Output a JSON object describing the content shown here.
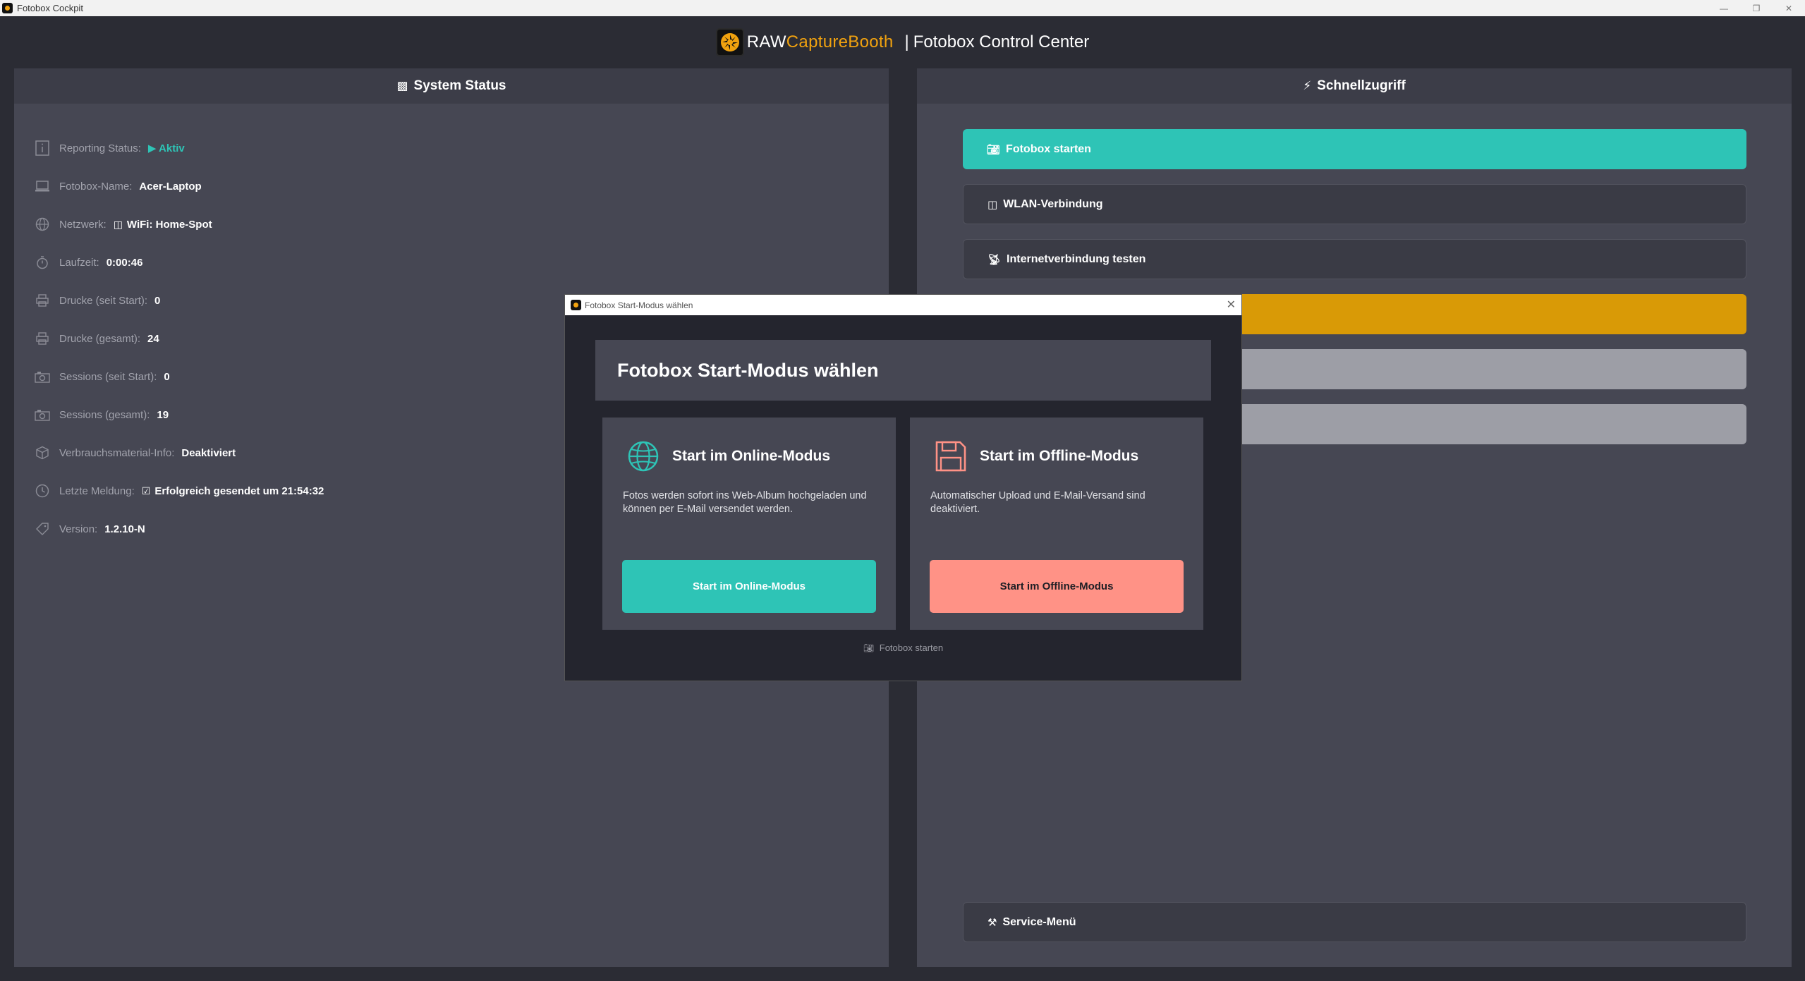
{
  "window": {
    "title": "Fotobox Cockpit",
    "controls": [
      "—",
      "❐",
      "✕"
    ]
  },
  "header": {
    "brand_raw": "RAW",
    "brand_capture": "CaptureBooth",
    "separator": "|",
    "subtitle": "Fotobox Control Center"
  },
  "system_status": {
    "title": "System Status",
    "rows": [
      {
        "icon": "info-icon",
        "label": "Reporting Status:",
        "value": "▶ Aktiv"
      },
      {
        "icon": "laptop-icon",
        "label": "Fotobox-Name:",
        "value": "Acer-Laptop"
      },
      {
        "icon": "globe-icon",
        "label": "Netzwerk:",
        "value": "WiFi: Home-Spot"
      },
      {
        "icon": "stopwatch-icon",
        "label": "Laufzeit:",
        "value": "0:00:46"
      },
      {
        "icon": "printer-icon",
        "label": "Drucke (seit Start):",
        "value": "0"
      },
      {
        "icon": "printer-icon",
        "label": "Drucke (gesamt):",
        "value": "24"
      },
      {
        "icon": "camera-icon",
        "label": "Sessions (seit Start):",
        "value": "0"
      },
      {
        "icon": "camera-icon",
        "label": "Sessions (gesamt):",
        "value": "19"
      },
      {
        "icon": "box-icon",
        "label": "Verbrauchsmaterial-Info:",
        "value": "Deaktiviert"
      },
      {
        "icon": "clock-icon",
        "label": "Letzte Meldung:",
        "value": "Erfolgreich gesendet um 21:54:32"
      },
      {
        "icon": "tag-icon",
        "label": "Version:",
        "value": "1.2.10-N"
      }
    ]
  },
  "quick_access": {
    "title": "Schnellzugriff",
    "buttons": {
      "start": "Fotobox starten",
      "wlan": "WLAN-Verbindung",
      "internet": "Internetverbindung testen",
      "service": "Service-Menü"
    }
  },
  "dialog": {
    "window_title": "Fotobox Start-Modus wählen",
    "heading": "Fotobox Start-Modus wählen",
    "online": {
      "title": "Start im Online-Modus",
      "description": "Fotos werden sofort ins Web-Album hochgeladen und können per E-Mail versendet werden.",
      "button": "Start im Online-Modus"
    },
    "offline": {
      "title": "Start im Offline-Modus",
      "description": "Automatischer Upload und E-Mail-Versand sind deaktiviert.",
      "button": "Start im Offline-Modus"
    },
    "footer": "Fotobox starten"
  },
  "colors": {
    "accent_teal": "#2ec4b6",
    "brand_orange": "#f1a20f",
    "warning_yellow": "#d99a06",
    "offline_salmon": "#ff9286",
    "panel_bg": "#464753",
    "app_bg": "#2b2c34"
  }
}
